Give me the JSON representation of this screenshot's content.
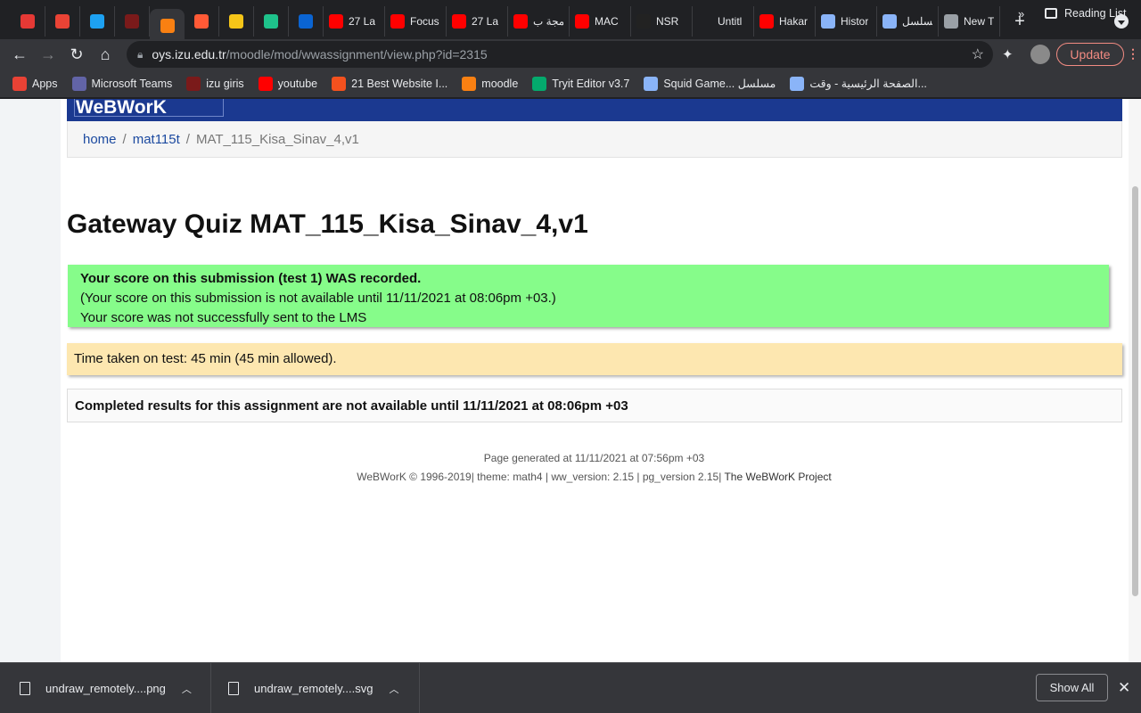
{
  "browser": {
    "tabs": [
      {
        "title": "",
        "icon": "red-app-icon",
        "color": "#e53935"
      },
      {
        "title": "",
        "icon": "gmail-icon",
        "color": "#ea4335"
      },
      {
        "title": "",
        "icon": "twitter-icon",
        "color": "#1da1f2"
      },
      {
        "title": "",
        "icon": "spider-icon",
        "color": "#7a1a1a"
      },
      {
        "title": "",
        "icon": "moodle-icon",
        "color": "#f98012",
        "active": true
      },
      {
        "title": "",
        "icon": "tt-icon",
        "color": "#ff5a36"
      },
      {
        "title": "",
        "icon": "e-coin-icon",
        "color": "#f5c518"
      },
      {
        "title": "",
        "icon": "m-icon",
        "color": "#1ec28b"
      },
      {
        "title": "",
        "icon": "outlook-icon",
        "color": "#0a64d2"
      },
      {
        "title": "27 La",
        "icon": "youtube-icon",
        "color": "#ff0000"
      },
      {
        "title": "Focus",
        "icon": "youtube-icon",
        "color": "#ff0000"
      },
      {
        "title": "27 La",
        "icon": "youtube-icon",
        "color": "#ff0000"
      },
      {
        "title": "برمجة ب",
        "icon": "youtube-icon",
        "color": "#ff0000"
      },
      {
        "title": "MAC",
        "icon": "youtube-icon",
        "color": "#ff0000"
      },
      {
        "title": "NSR",
        "icon": "nsr-icon",
        "color": "#222222"
      },
      {
        "title": "Untitl",
        "icon": "blank-page-icon",
        "color": "#202124"
      },
      {
        "title": "Hakar",
        "icon": "youtube-icon",
        "color": "#ff0000"
      },
      {
        "title": "Histor",
        "icon": "history-icon",
        "color": "#8ab4f8"
      },
      {
        "title": "مسلسل",
        "icon": "location-pin-icon",
        "color": "#8ab4f8"
      },
      {
        "title": "New T",
        "icon": "chrome-icon",
        "color": "#9aa0a6"
      }
    ],
    "new_tab": "+",
    "url_host": "oys.izu.edu.tr",
    "url_path": "/moodle/mod/wwassignment/view.php?id=2315",
    "update_label": "Update",
    "bookmarks": [
      {
        "label": "Apps",
        "icon": "apps-grid-icon",
        "color": "#e94235"
      },
      {
        "label": "Microsoft Teams",
        "icon": "teams-icon",
        "color": "#6264a7"
      },
      {
        "label": "izu giris",
        "icon": "spider-icon",
        "color": "#7a1a1a"
      },
      {
        "label": "youtube",
        "icon": "youtube-icon",
        "color": "#ff0000"
      },
      {
        "label": "21 Best Website I...",
        "icon": "orange-box-icon",
        "color": "#f4511e"
      },
      {
        "label": "moodle",
        "icon": "moodle-icon",
        "color": "#f98012"
      },
      {
        "label": "Tryit Editor v3.7",
        "icon": "w3-icon",
        "color": "#04aa6d"
      },
      {
        "label": "Squid Game... مسلسل",
        "icon": "location-pin-icon",
        "color": "#8ab4f8"
      },
      {
        "label": "الصفحة الرئيسية - وقت...",
        "icon": "location-pin-icon",
        "color": "#8ab4f8"
      }
    ],
    "bookmarks_more": "»",
    "reading_list": "Reading List"
  },
  "page": {
    "logo": "WeBWorK",
    "breadcrumb": {
      "home": "home",
      "course": "mat115t",
      "current": "MAT_115_Kisa_Sinav_4,v1",
      "sep": "/"
    },
    "title": "Gateway Quiz MAT_115_Kisa_Sinav_4,v1",
    "score_box": {
      "line1": "Your score on this submission (test 1) WAS recorded.",
      "line2": "(Your score on this submission is not available until 11/11/2021 at 08:06pm +03.)",
      "line3": "Your score was not successfully sent to the LMS"
    },
    "time_taken": "Time taken on test: 45 min (45 min allowed).",
    "results_notice": "Completed results for this assignment are not available until 11/11/2021 at 08:06pm +03",
    "footer": {
      "generated": "Page generated at 11/11/2021 at 07:56pm +03",
      "copyright": "WeBWorK © 1996-2019| theme: math4 | ww_version: 2.15 | pg_version 2.15|",
      "project": "The WeBWorK Project"
    }
  },
  "downloads": {
    "items": [
      {
        "name": "undraw_remotely....png"
      },
      {
        "name": "undraw_remotely....svg"
      }
    ],
    "show_all": "Show All"
  }
}
